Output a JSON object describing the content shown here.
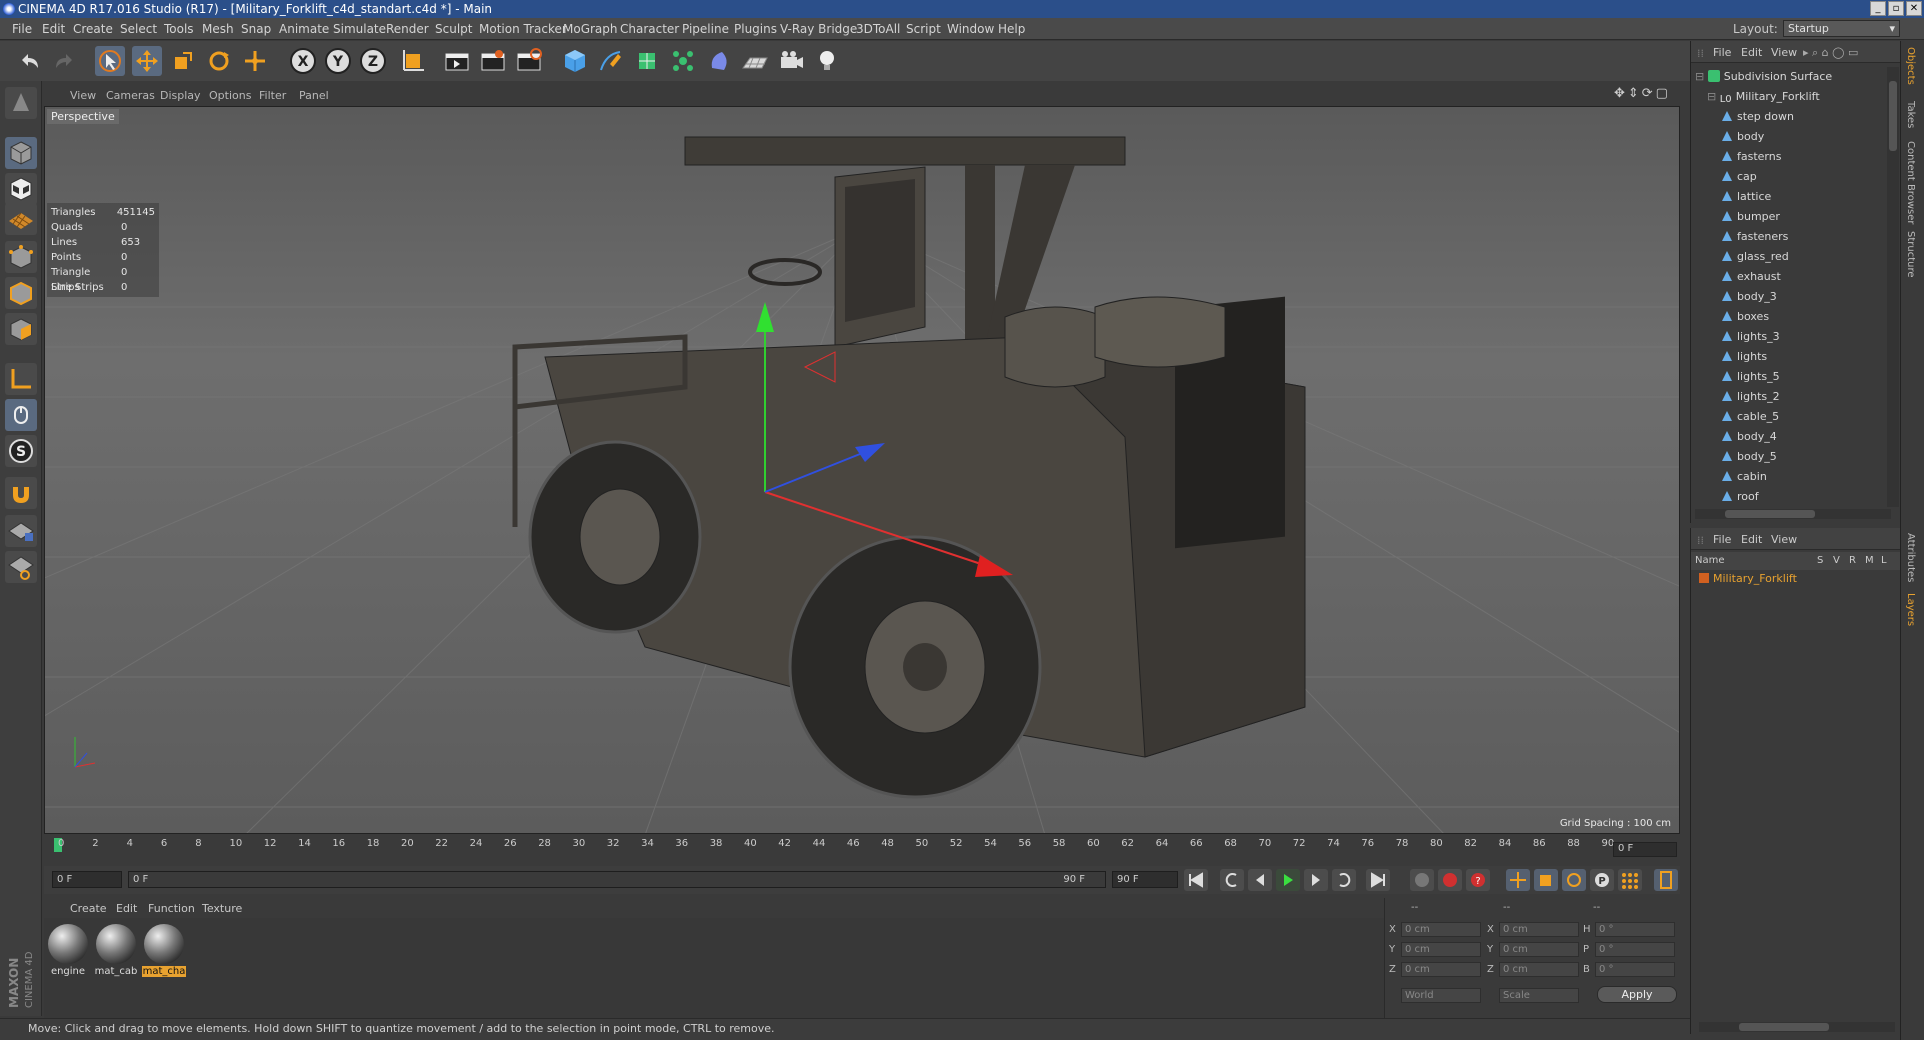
{
  "window": {
    "title": "CINEMA 4D R17.016 Studio (R17) - [Military_Forklift_c4d_standart.c4d *] - Main"
  },
  "menubar": {
    "items": [
      "File",
      "Edit",
      "Create",
      "Select",
      "Tools",
      "Mesh",
      "Snap",
      "Animate",
      "Simulate",
      "Render",
      "Sculpt",
      "Motion Tracker",
      "MoGraph",
      "Character",
      "Pipeline",
      "Plugins",
      "V-Ray Bridge",
      "3DToAll",
      "Script",
      "Window",
      "Help"
    ],
    "layout_label": "Layout:",
    "layout_value": "Startup"
  },
  "viewport": {
    "menu": [
      "View",
      "Cameras",
      "Display",
      "Options",
      "Filter",
      "Panel"
    ],
    "label": "Perspective",
    "stats": [
      {
        "name": "Triangles",
        "value": "451145"
      },
      {
        "name": "Quads",
        "value": "0"
      },
      {
        "name": "Lines",
        "value": "653"
      },
      {
        "name": "Points",
        "value": "0"
      },
      {
        "name": "Triangle Strips",
        "value": "0"
      },
      {
        "name": "Line Strips",
        "value": "0"
      }
    ],
    "grid_spacing": "Grid Spacing : 100 cm"
  },
  "timeline": {
    "ticks": [
      "0",
      "2",
      "4",
      "6",
      "8",
      "10",
      "12",
      "14",
      "16",
      "18",
      "20",
      "22",
      "24",
      "26",
      "28",
      "30",
      "32",
      "34",
      "36",
      "38",
      "40",
      "42",
      "44",
      "46",
      "48",
      "50",
      "52",
      "54",
      "56",
      "58",
      "60",
      "62",
      "64",
      "66",
      "68",
      "70",
      "72",
      "74",
      "76",
      "78",
      "80",
      "82",
      "84",
      "86",
      "88",
      "90"
    ],
    "current_frame": "0 F",
    "start_field": "0 F",
    "range_start": "0 F",
    "range_end": "90 F",
    "end_field": "90 F"
  },
  "materials": {
    "menu": [
      "Create",
      "Edit",
      "Function",
      "Texture"
    ],
    "items": [
      {
        "name": "engine",
        "selected": false
      },
      {
        "name": "mat_cab",
        "selected": false
      },
      {
        "name": "mat_cha",
        "selected": true
      }
    ]
  },
  "coordinates": {
    "headers": [
      "--",
      "--",
      "--"
    ],
    "rows": [
      {
        "a": "X",
        "av": "0 cm",
        "b": "X",
        "bv": "0 cm",
        "c": "H",
        "cv": "0 °"
      },
      {
        "a": "Y",
        "av": "0 cm",
        "b": "Y",
        "bv": "0 cm",
        "c": "P",
        "cv": "0 °"
      },
      {
        "a": "Z",
        "av": "0 cm",
        "b": "Z",
        "bv": "0 cm",
        "c": "B",
        "cv": "0 °"
      }
    ],
    "mode1": "World",
    "mode2": "Scale",
    "apply": "Apply"
  },
  "status": "Move: Click and drag to move elements. Hold down SHIFT to quantize movement / add to the selection in point mode, CTRL to remove.",
  "object_manager": {
    "menu": [
      "File",
      "Edit",
      "View"
    ],
    "root": "Subdivision Surface",
    "group": "Military_Forklift",
    "children": [
      "step down",
      "body",
      "fasterns",
      "cap",
      "lattice",
      "bumper",
      "fasteners",
      "glass_red",
      "exhaust",
      "body_3",
      "boxes",
      "lights_3",
      "lights",
      "lights_5",
      "lights_2",
      "cable_5",
      "body_4",
      "body_5",
      "cabin",
      "roof"
    ]
  },
  "layer_manager": {
    "menu": [
      "File",
      "Edit",
      "View"
    ],
    "columns": [
      "Name",
      "S",
      "V",
      "R",
      "M",
      "L"
    ],
    "row": "Military_Forklift"
  },
  "side_tabs": [
    "Objects",
    "Takes",
    "Content Browser",
    "Structure",
    "Attributes",
    "Layers"
  ],
  "colors": {
    "accent": "#e8a230",
    "titlebar": "#2b4f8a",
    "axis_x": "#e03030",
    "axis_y": "#30c030",
    "axis_z": "#3050e0"
  }
}
